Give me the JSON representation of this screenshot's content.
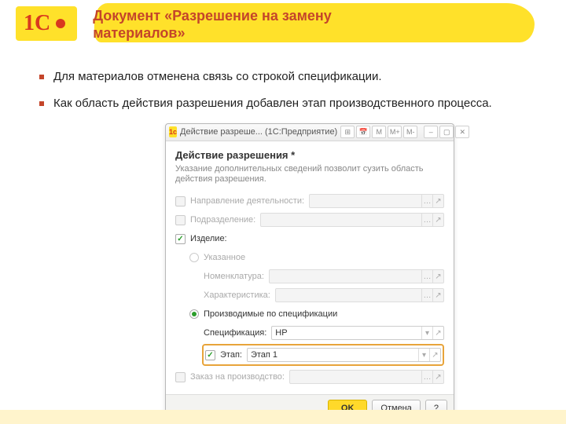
{
  "slide": {
    "title": "Документ «Разрешение на замену материалов»",
    "bullets": [
      "Для материалов отменена связь со строкой спецификации.",
      "Как область действия разрешения добавлен этап производственного процесса."
    ]
  },
  "window": {
    "title": "Действие разреше... (1С:Предприятие)",
    "toolbar_icons": [
      "calc-icon",
      "calendar-icon",
      "m-icon",
      "m-plus-icon",
      "m-minus-icon",
      "min-icon",
      "restore-icon",
      "close-icon"
    ],
    "section_title": "Действие разрешения *",
    "hint": "Указание дополнительных сведений позволит сузить область действия разрешения.",
    "fields": {
      "direction": {
        "label": "Направление деятельности:",
        "checked": false,
        "value": ""
      },
      "subdivision": {
        "label": "Подразделение:",
        "checked": false,
        "value": ""
      },
      "product": {
        "label": "Изделие:",
        "checked": true,
        "specified_label": "Указанное",
        "nomenclature_label": "Номенклатура:",
        "characteristic_label": "Характеристика:",
        "by_spec_label": "Производимые по спецификации",
        "spec_label": "Спецификация:",
        "spec_value": "НР",
        "stage_label": "Этап:",
        "stage_value": "Этап 1",
        "stage_checked": true
      },
      "order": {
        "label": "Заказ на производство:",
        "checked": false,
        "value": ""
      }
    },
    "buttons": {
      "ok": "OK",
      "cancel": "Отмена",
      "help": "?"
    }
  }
}
